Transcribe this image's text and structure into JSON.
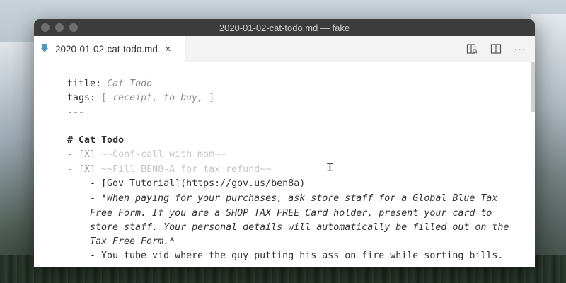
{
  "window": {
    "title": "2020-01-02-cat-todo.md — fake"
  },
  "tab": {
    "label": "2020-01-02-cat-todo.md",
    "close": "×",
    "icon": "markdown-arrow-icon"
  },
  "actions": {
    "more": "···"
  },
  "editor": {
    "fm_open": "---",
    "title_key": "title:",
    "title_value": "Cat Todo",
    "tags_key": "tags:",
    "tags_open": "[",
    "tags_values": "receipt, to buy,",
    "tags_close": "]",
    "fm_close": "---",
    "heading_mark": "#",
    "heading_text": "Cat Todo",
    "todo1_prefix": "- [X]",
    "todo1_text": "~~Conf-call with mom~~",
    "todo2_prefix": "- [X]",
    "todo2_text": "~~Fill BEN8-A for tax refund~~",
    "sub1_prefix": "- [Gov Tutorial](",
    "sub1_url": "https://gov.us/ben8a",
    "sub1_suffix": ")",
    "sub2_line1_prefix": "- ",
    "sub2_line1": "*When paying for your purchases, ask store staff for a Global Blue Tax",
    "sub2_line2": "Free Form. If you are a SHOP TAX FREE Card holder, present your card to",
    "sub2_line3": "store staff. Your personal details will automatically be filled out on the",
    "sub2_line4": "Tax Free Form.*",
    "sub3": "- You tube vid where the guy putting his ass on fire while sorting bills."
  }
}
